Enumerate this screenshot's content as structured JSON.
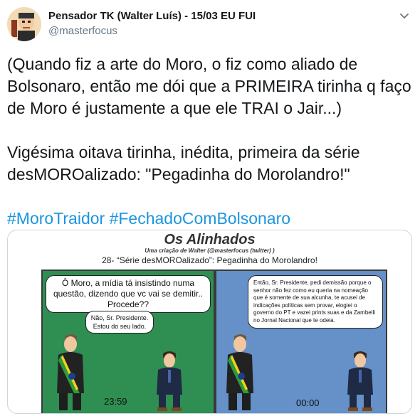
{
  "tweet": {
    "author_name": "Pensador TK (Walter Luís) - 15/03 EU FUI",
    "author_handle": "@masterfocus",
    "paragraphs": [
      "(Quando fiz a arte do Moro, o fiz como aliado de Bolsonaro, então me dói que a PRIMEIRA tirinha q faço de Moro é justamente a que ele TRAI o Jair...)",
      "Vigésima oitava tirinha, inédita, primeira da série desMOROalizado: \"Pegadinha do Morolandro!\""
    ],
    "hashtags": [
      "#MoroTraidor",
      "#FechadoComBolsonaro"
    ]
  },
  "comic": {
    "title": "Os Alinhados",
    "subtitle": "Uma criação de Walter (@masterfocus (twitter) )",
    "strip_title": "28- “Série desMOROalizado”: Pegadinha do Morolandro!",
    "panel1": {
      "bubble_left": "Ô Moro, a mídia tá insistindo numa questão, dizendo que vc vai se demitir.. Procede??",
      "bubble_right": "Não, Sr. Presidente. Estou do seu lado.",
      "clock": "23:59"
    },
    "panel2": {
      "bubble": "Então, Sr. Presidente, pedi demissão porque o senhor não fez como eu queria na nomeação que é somente de sua alcunha, te acusei de indicações políticas sem provar, elogiei o governo do PT e vazei prints suas e da Zambelli no Jornal Nacional que te odeia.",
      "clock": "00:00"
    }
  },
  "icons": {
    "avatar": "cartoon-avatar",
    "menu": "chevron-down-icon"
  },
  "colors": {
    "hashtag": "#1b95e0",
    "panel1_bg": "#2f8f52",
    "panel2_bg": "#6690c8"
  }
}
